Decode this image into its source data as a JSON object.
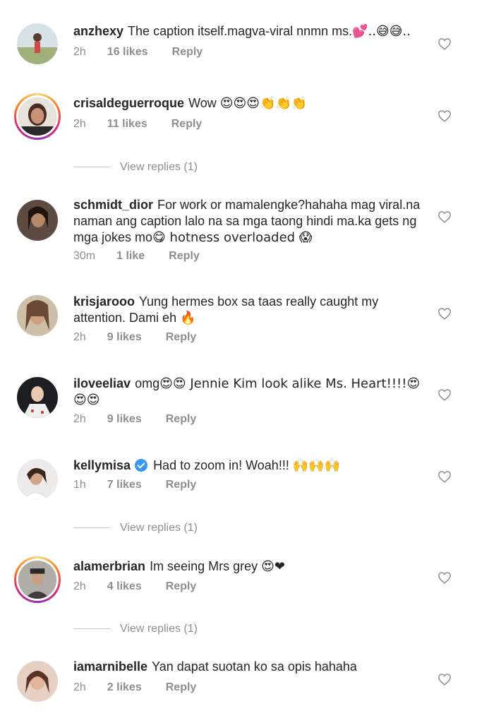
{
  "comments": [
    {
      "username": "anzhexy",
      "text": "The caption itself.magva-viral nnmn ms.",
      "emoji": "💕..😅😅..",
      "time": "2h",
      "likes": "16 likes",
      "reply": "Reply",
      "avatar_color": "#b8c9a3"
    },
    {
      "username": "crisaldeguerroque",
      "text": "Wow",
      "emoji": "😍😍😍👏👏👏",
      "time": "2h",
      "likes": "11 likes",
      "reply": "Reply",
      "avatar_color": "#6b4a3a"
    },
    {
      "username": "schmidt_dior",
      "text": "For work or mamalengke?hahaha mag viral.na naman ang caption lalo na sa mga taong hindi ma.ka gets ng mga jokes mo",
      "emoji": "😋 hotness overloaded 😱",
      "time": "30m",
      "likes": "1 like",
      "reply": "Reply",
      "avatar_color": "#3a2a24"
    },
    {
      "username": "krisjarooo",
      "text": "Yung hermes box sa taas really caught my attention. Dami eh",
      "emoji": "🔥",
      "time": "2h",
      "likes": "9 likes",
      "reply": "Reply",
      "avatar_color": "#8a7060"
    },
    {
      "username": "iloveeliav",
      "text": "omg",
      "emoji": "😍😍 Jennie Kim look alike Ms. Heart!!!!😍😍😍",
      "time": "2h",
      "likes": "9 likes",
      "reply": "Reply",
      "avatar_color": "#2c2c30"
    },
    {
      "username": "kellymisa",
      "text": "Had to zoom in! Woah!!!",
      "emoji": "🙌🙌🙌",
      "time": "1h",
      "likes": "7 likes",
      "reply": "Reply",
      "avatar_color": "#d9d4cf"
    },
    {
      "username": "alamerbrian",
      "text": "Im seeing Mrs grey",
      "emoji": "😍❤",
      "time": "2h",
      "likes": "4 likes",
      "reply": "Reply",
      "avatar_color": "#6e6a66"
    },
    {
      "username": "iamarnibelle",
      "text": "Yan dapat suotan ko sa opis hahaha",
      "emoji": "",
      "time": "2h",
      "likes": "2 likes",
      "reply": "Reply",
      "avatar_color": "#c99a86"
    }
  ],
  "view_replies": [
    "View replies (1)",
    "View replies (1)",
    "View replies (1)"
  ],
  "colors": {
    "heart_stroke": "#8e8e8e",
    "meta_text": "#8e8e8e",
    "verified_blue": "#3897f0"
  }
}
